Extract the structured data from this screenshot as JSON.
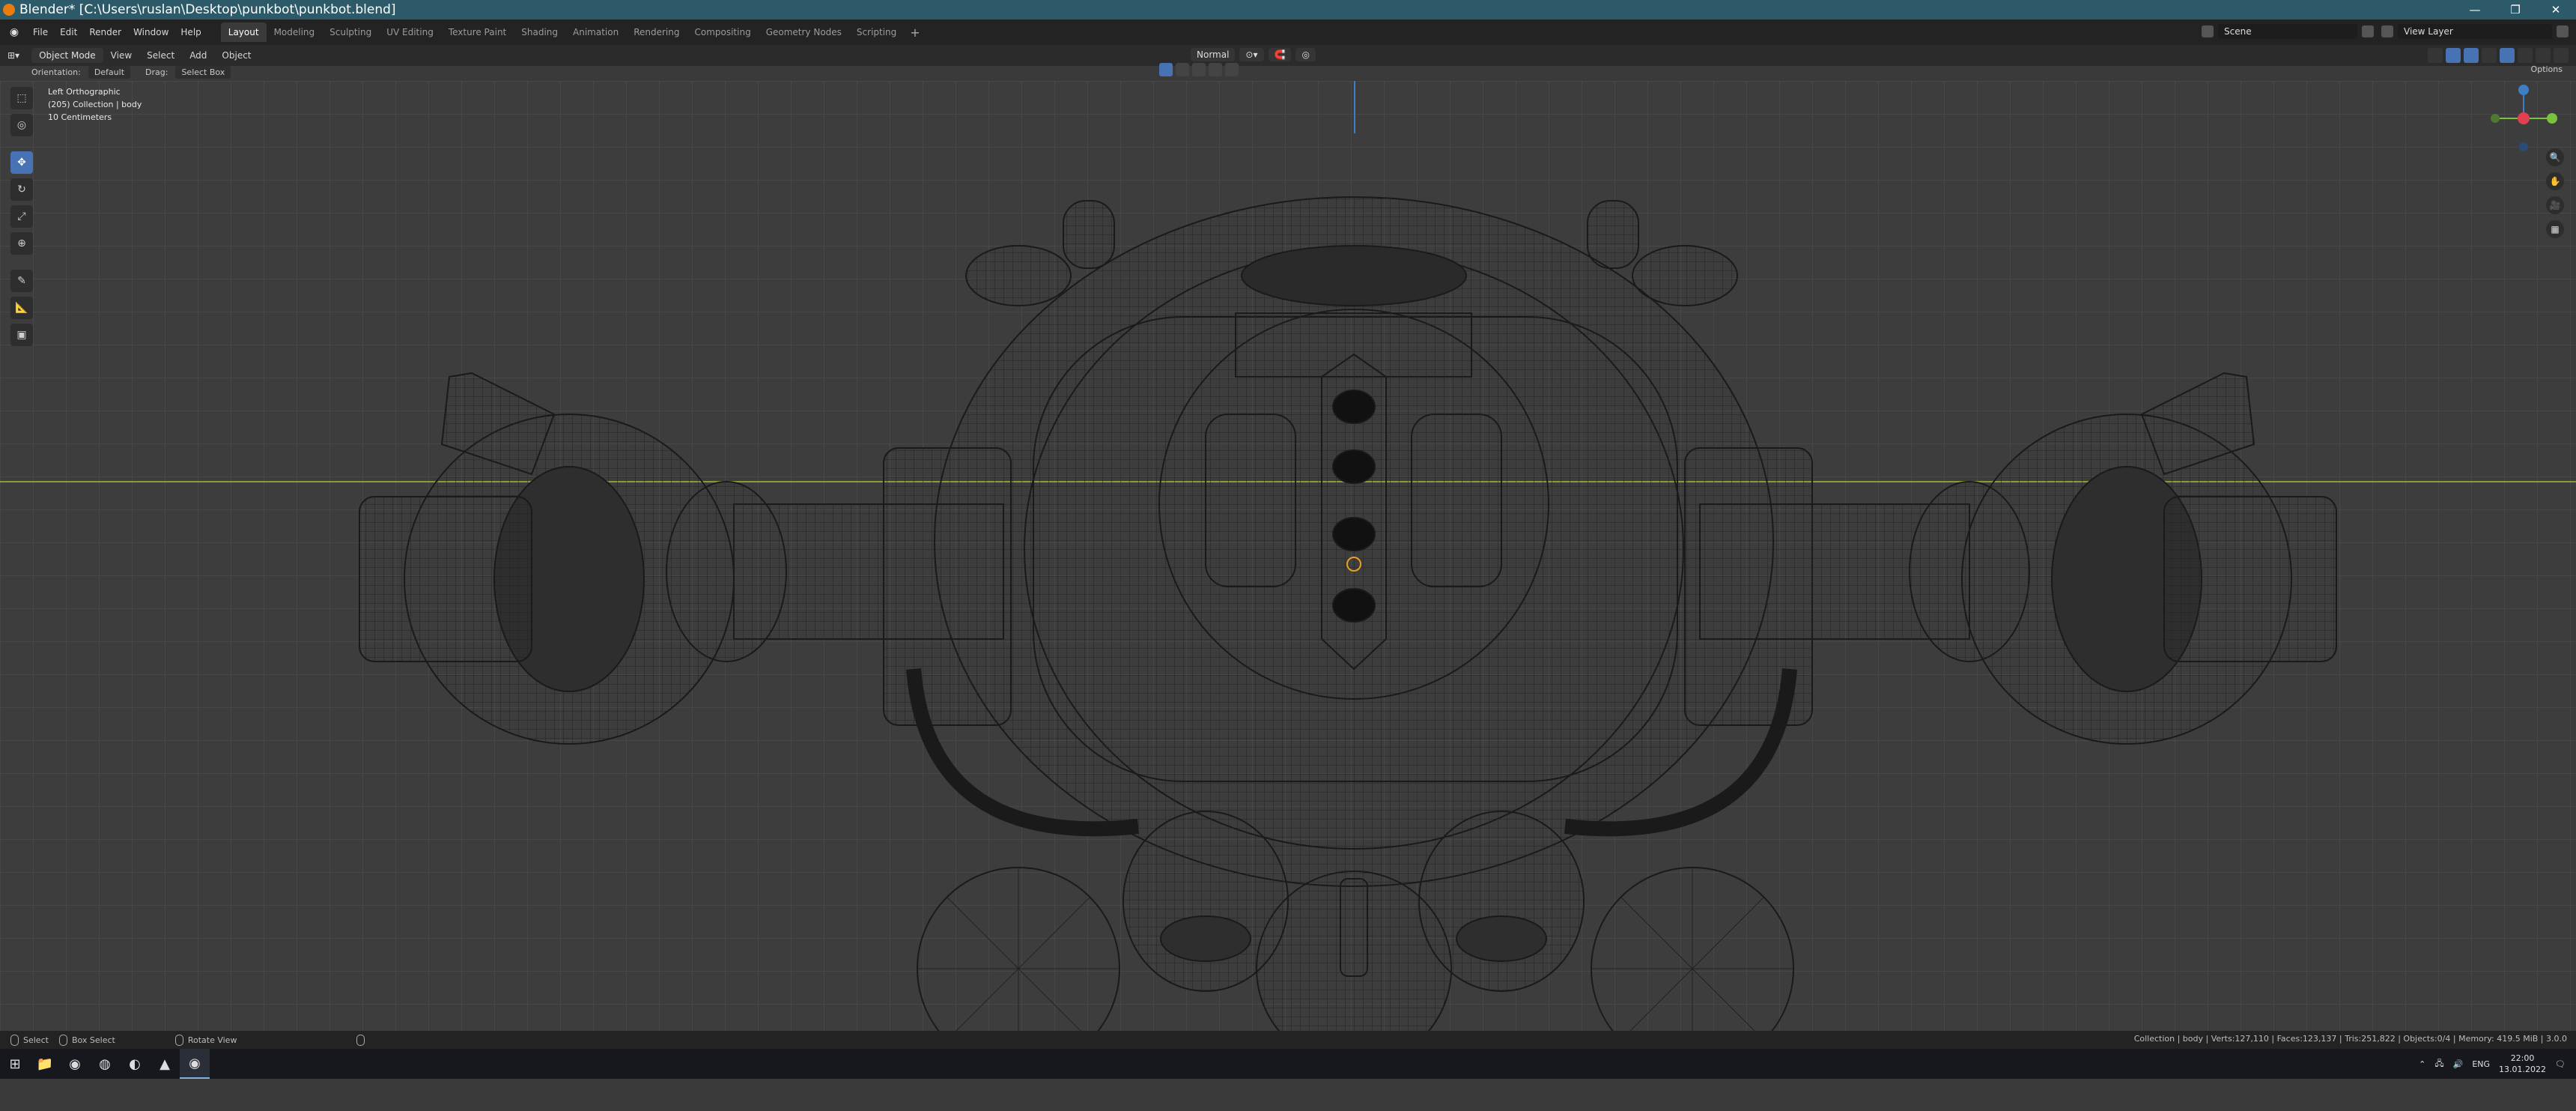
{
  "window": {
    "title": "Blender* [C:\\Users\\ruslan\\Desktop\\punkbot\\punkbot.blend]",
    "controls": [
      "—",
      "❐",
      "✕"
    ]
  },
  "menubar": {
    "menus": [
      "File",
      "Edit",
      "Render",
      "Window",
      "Help"
    ],
    "workspaces": [
      "Layout",
      "Modeling",
      "Sculpting",
      "UV Editing",
      "Texture Paint",
      "Shading",
      "Animation",
      "Rendering",
      "Compositing",
      "Geometry Nodes",
      "Scripting"
    ],
    "active_workspace": "Layout",
    "add_symbol": "+",
    "scene_label": "Scene",
    "view_layer_label": "View Layer"
  },
  "header": {
    "mode": "Object Mode",
    "menus": [
      "View",
      "Select",
      "Add",
      "Object"
    ],
    "orientation_dropdown": "Normal"
  },
  "tool_header": {
    "orientation_label": "Orientation:",
    "orientation_value": "Default",
    "drag_label": "Drag:",
    "drag_value": "Select Box",
    "options_label": "Options"
  },
  "viewport": {
    "view_name": "Left Orthographic",
    "collection_info": "(205) Collection | body",
    "scale_info": "10 Centimeters"
  },
  "tools": [
    {
      "name": "select-box-tool",
      "icon": "⬚",
      "active": false
    },
    {
      "name": "cursor-tool",
      "icon": "◎",
      "active": false
    },
    {
      "name": "move-tool",
      "icon": "✥",
      "active": true
    },
    {
      "name": "rotate-tool",
      "icon": "↻",
      "active": false
    },
    {
      "name": "scale-tool",
      "icon": "⤢",
      "active": false
    },
    {
      "name": "transform-tool",
      "icon": "⊕",
      "active": false
    },
    {
      "name": "annotate-tool",
      "icon": "✎",
      "active": false
    },
    {
      "name": "measure-tool",
      "icon": "📐",
      "active": false
    },
    {
      "name": "add-cube-tool",
      "icon": "▣",
      "active": false
    }
  ],
  "gizmo": {
    "x_label": "X",
    "y_label": "Y",
    "z_label": "Z"
  },
  "statusbar": {
    "select": "Select",
    "box_select": "Box Select",
    "rotate_view": "Rotate View",
    "stats": "Collection | body | Verts:127,110 | Faces:123,137 | Tris:251,822 | Objects:0/4 | Memory: 419.5 MiB | 3.0.0"
  },
  "taskbar": {
    "language": "ENG",
    "time": "22:00",
    "date": "13.01.2022",
    "apps": [
      "windows-start",
      "file-explorer",
      "chrome",
      "discord",
      "steam",
      "app-orange",
      "blender"
    ]
  },
  "colors": {
    "titlebar": "#2c5a68",
    "accent": "#4772b3",
    "x_axis": "#e04050",
    "y_axis": "#7cc040",
    "z_axis": "#3e7fc4"
  }
}
